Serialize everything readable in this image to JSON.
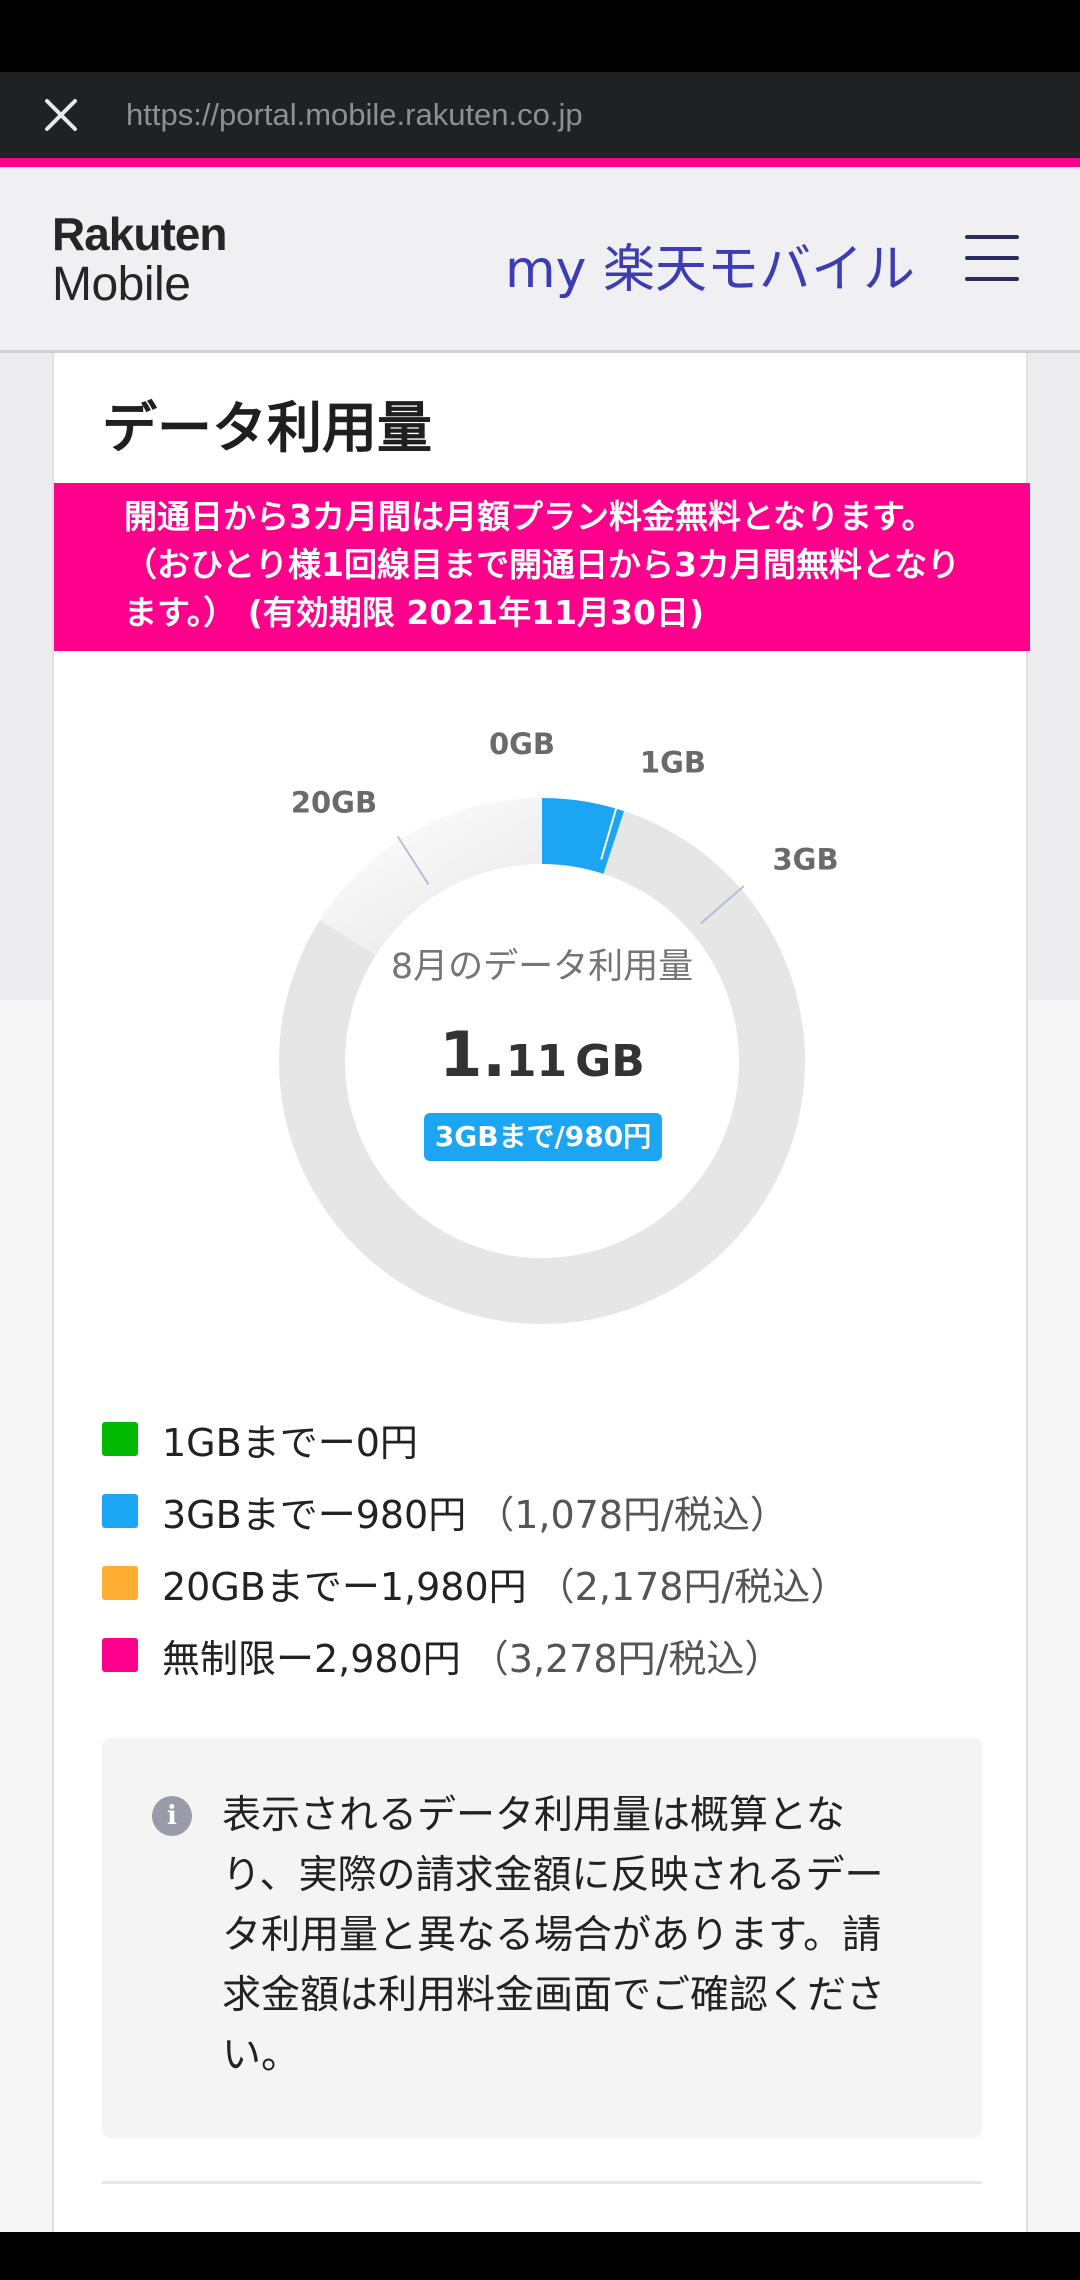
{
  "browser": {
    "url": "https://portal.mobile.rakuten.co.jp"
  },
  "header": {
    "logo_line1": "Rakuten",
    "logo_line2": "Mobile",
    "title": "my 楽天モバイル"
  },
  "card": {
    "title": "データ利用量",
    "promo": "開通日から3カ月間は月額プラン料金無料となります。（おひとり様1回線目まで開通日から3カ月間無料となります。） (有効期限 2021年11月30日)",
    "center_label": "8月のデータ利用量",
    "usage_big": "1.",
    "usage_small": "11",
    "usage_unit": "GB",
    "tier_badge": "3GBまで/980円"
  },
  "chart_data": {
    "type": "donut",
    "max_gb": 22,
    "used_gb": 1.11,
    "markers": [
      {
        "label": "0GB",
        "gb": 0
      },
      {
        "label": "1GB",
        "gb": 1
      },
      {
        "label": "3GB",
        "gb": 3
      },
      {
        "label": "20GB",
        "gb": 20
      }
    ],
    "colors": {
      "used": "#1ba5f2",
      "track": "#e6e6e6"
    }
  },
  "legend": [
    {
      "label": "1GBまでー0円",
      "tax": "",
      "color": "#00b900"
    },
    {
      "label": "3GBまでー980円",
      "tax": "（1,078円/税込）",
      "color": "#1ba5f2"
    },
    {
      "label": "20GBまでー1,980円",
      "tax": "（2,178円/税込）",
      "color": "#ffad33"
    },
    {
      "label": "無制限ー2,980円",
      "tax": "（3,278円/税込）",
      "color": "#ff008c"
    }
  ],
  "notice": {
    "icon": "info-icon",
    "text": "表示されるデータ利用量は概算となり、実際の請求金額に反映されるデータ利用量と異なる場合があります。請求金額は利用料金画面でご確認ください。"
  }
}
